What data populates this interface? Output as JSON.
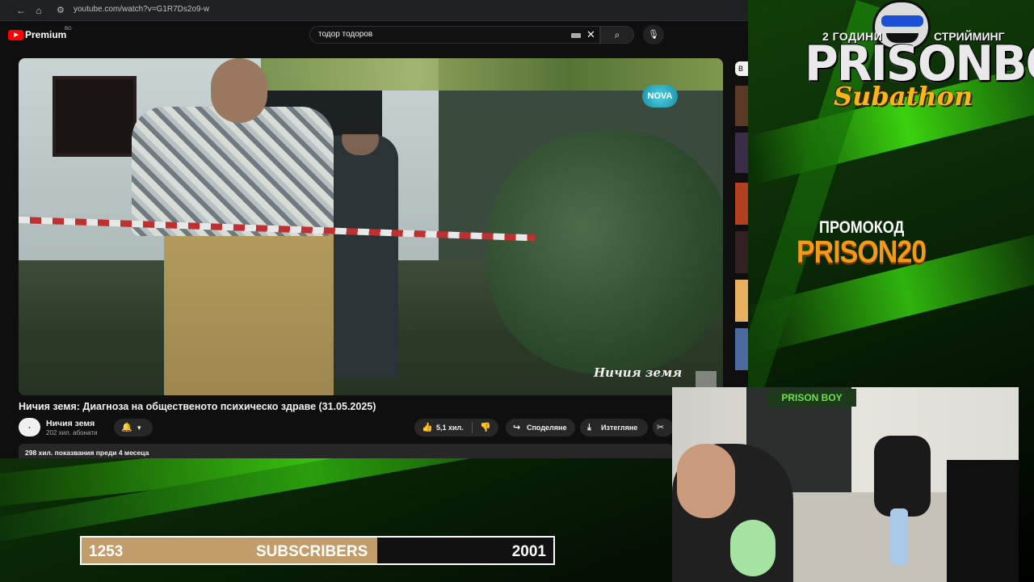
{
  "browser": {
    "url": "youtube.com/watch?v=G1R7Ds2o9-w"
  },
  "youtube": {
    "brand": "Premium",
    "country": "BG",
    "search_value": "тодор тодоров",
    "channel_watermark": "NOVA",
    "video_caption": "Ничия земя",
    "video_title": "Ничия земя: Диагноза на общественото психическо здраве (31.05.2025)",
    "channel_name": "Ничия земя",
    "channel_subs": "202 хил. абонати",
    "likes": "5,1 хил.",
    "share_label": "Споделяне",
    "download_label": "Изтегляне",
    "description_meta": "298 хил. показвания  преди 4 месеца",
    "side_button_label": "В"
  },
  "overlay": {
    "years": "2 ГОДИНИ",
    "streaming": "СТРИЙМИНГ",
    "brand": "PRISONBOY",
    "event": "Subathon",
    "promo_label": "ПРОМОКОД",
    "promo_code": "PRISON20",
    "webcam_sign": "PRISON BOY",
    "colors": {
      "promo": "#f29a17",
      "subathon": "#f7b718",
      "accent_green": "#2fd10a"
    }
  },
  "subscriber_goal": {
    "current": "1253",
    "label": "SUBSCRIBERS",
    "goal": "2001",
    "progress_fraction": 0.6263
  },
  "icons": {
    "back": "arrow-left-icon",
    "home": "home-icon",
    "site_settings": "tune-icon",
    "keyboard": "keyboard-icon",
    "clear": "close-icon",
    "search": "search-icon",
    "mic": "mic-icon",
    "bell": "bell-icon",
    "chevron": "chevron-down-icon",
    "like": "thumb-up-icon",
    "dislike": "thumb-down-icon",
    "share": "share-icon",
    "download": "download-icon",
    "clip": "scissors-icon"
  }
}
